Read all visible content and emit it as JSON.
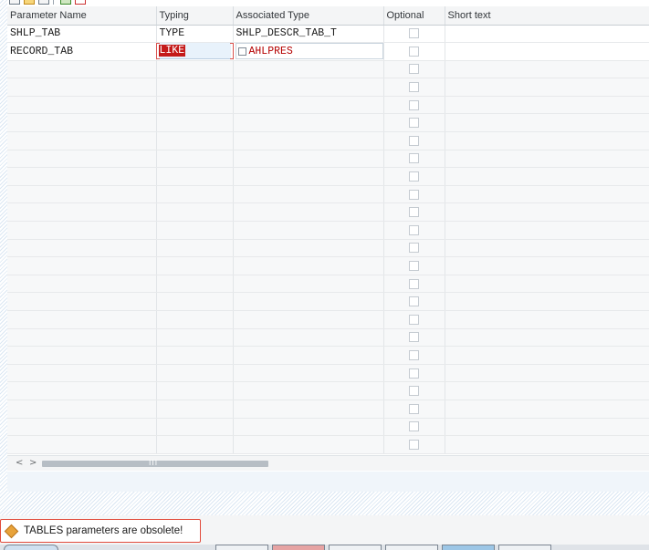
{
  "columns": [
    "Parameter Name",
    "Typing",
    "Associated Type",
    "Optional",
    "Short text"
  ],
  "rows": [
    {
      "name": "SHLP_TAB",
      "typing": "TYPE",
      "assoc": "SHLP_DESCR_TAB_T"
    },
    {
      "name": "RECORD_TAB",
      "typing": "LIKE",
      "assoc": "AHLPRES"
    }
  ],
  "empty_row_count": 22,
  "scrollbar": {
    "left": "<",
    "right": ">",
    "grip": "III"
  },
  "status_message": {
    "text": "TABLES parameters are obsolete!",
    "icon": "warning-icon",
    "color": "#e8a33a"
  },
  "colors": {
    "accent_red": "#c41a1a",
    "header_bg": "#f4f5f6"
  }
}
